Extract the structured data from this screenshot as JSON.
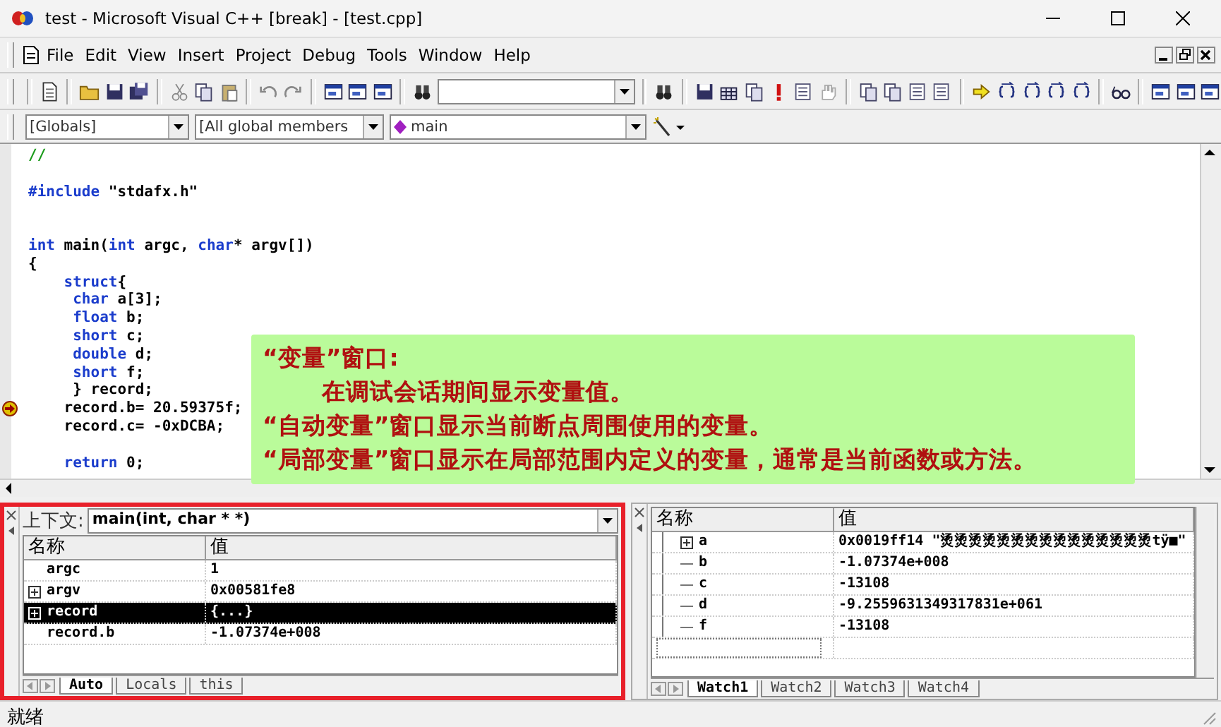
{
  "window": {
    "title": "test - Microsoft Visual C++ [break] - [test.cpp]"
  },
  "menu": [
    {
      "label": "File"
    },
    {
      "label": "Edit"
    },
    {
      "label": "View"
    },
    {
      "label": "Insert"
    },
    {
      "label": "Project"
    },
    {
      "label": "Debug"
    },
    {
      "label": "Tools"
    },
    {
      "label": "Window"
    },
    {
      "label": "Help"
    }
  ],
  "scope_bar": {
    "class_combo": "[Globals]",
    "members_combo": "[All global members",
    "function_combo": "main"
  },
  "editor": {
    "lines": [
      {
        "current": false,
        "segments": [
          {
            "kind": "comment",
            "text": "//"
          }
        ]
      },
      {
        "current": false
      },
      {
        "current": false,
        "segments": [
          {
            "kind": "kw",
            "text": "#include"
          },
          {
            "kind": "text",
            "text": " \"stdafx.h\""
          }
        ]
      },
      {
        "current": false
      },
      {
        "current": false
      },
      {
        "current": false,
        "segments": [
          {
            "kind": "kw",
            "text": "int"
          },
          {
            "kind": "text",
            "text": " main("
          },
          {
            "kind": "kw",
            "text": "int"
          },
          {
            "kind": "text",
            "text": " argc, "
          },
          {
            "kind": "kw",
            "text": "char"
          },
          {
            "kind": "text",
            "text": "* argv[])"
          }
        ]
      },
      {
        "current": false,
        "segments": [
          {
            "kind": "text",
            "text": "{"
          }
        ]
      },
      {
        "current": false,
        "segments": [
          {
            "kind": "kw",
            "text": "    struct"
          },
          {
            "kind": "text",
            "text": "{"
          }
        ]
      },
      {
        "current": false,
        "segments": [
          {
            "kind": "kw",
            "text": "     char"
          },
          {
            "kind": "text",
            "text": " a[3];"
          }
        ]
      },
      {
        "current": false,
        "segments": [
          {
            "kind": "kw",
            "text": "     float"
          },
          {
            "kind": "text",
            "text": " b;"
          }
        ]
      },
      {
        "current": false,
        "segments": [
          {
            "kind": "kw",
            "text": "     short"
          },
          {
            "kind": "text",
            "text": " c;"
          }
        ]
      },
      {
        "current": false,
        "segments": [
          {
            "kind": "kw",
            "text": "     double"
          },
          {
            "kind": "text",
            "text": " d;"
          }
        ]
      },
      {
        "current": false,
        "segments": [
          {
            "kind": "kw",
            "text": "     short"
          },
          {
            "kind": "text",
            "text": " f;"
          }
        ]
      },
      {
        "current": false,
        "segments": [
          {
            "kind": "text",
            "text": "     } record;"
          }
        ]
      },
      {
        "current": true,
        "segments": [
          {
            "kind": "text",
            "text": "    record.b= 20.59375f;"
          }
        ]
      },
      {
        "current": false,
        "segments": [
          {
            "kind": "text",
            "text": "    record.c= -0xDCBA;"
          }
        ]
      },
      {
        "current": false
      },
      {
        "current": false,
        "segments": [
          {
            "kind": "kw",
            "text": "    return"
          },
          {
            "kind": "text",
            "text": " 0;"
          }
        ]
      }
    ]
  },
  "callout": {
    "lines": [
      {
        "text": "“变量”窗口:",
        "indented": false
      },
      {
        "text": "在调试会话期间显示变量值。",
        "indented": true
      },
      {
        "text": "“自动变量”窗口显示当前断点周围使用的变量。",
        "indented": false
      },
      {
        "text": "“局部变量”窗口显示在局部范围内定义的变量，通常是当前函数或方法。",
        "indented": false
      }
    ]
  },
  "variables": {
    "context_label": "上下文:",
    "context": "main(int, char * *)",
    "columns": [
      "名称",
      "值"
    ],
    "rows": [
      {
        "name": "argc",
        "value": "1",
        "expandable": false,
        "selected": false
      },
      {
        "name": "argv",
        "value": "0x00581fe8",
        "expandable": true,
        "selected": false
      },
      {
        "name": "record",
        "value": "{...}",
        "expandable": true,
        "selected": true
      },
      {
        "name": "record.b",
        "value": "-1.07374e+008",
        "expandable": false,
        "selected": false
      }
    ],
    "tabs": [
      {
        "label": "Auto",
        "selected": true
      },
      {
        "label": "Locals",
        "selected": false
      },
      {
        "label": "this",
        "selected": false
      }
    ]
  },
  "watch": {
    "columns": [
      "名称",
      "值"
    ],
    "rows": [
      {
        "name": "a",
        "value": "0x0019ff14 \"烫烫烫烫烫烫烫烫烫烫烫烫烫烫烫tÿ■\"",
        "expandable": true
      },
      {
        "name": "b",
        "value": "-1.07374e+008",
        "expandable": false
      },
      {
        "name": "c",
        "value": "-13108",
        "expandable": false
      },
      {
        "name": "d",
        "value": "-9.2559631349317831e+061",
        "expandable": false
      },
      {
        "name": "f",
        "value": "-13108",
        "expandable": false
      }
    ],
    "tabs": [
      {
        "label": "Watch1",
        "selected": true
      },
      {
        "label": "Watch2",
        "selected": false
      },
      {
        "label": "Watch3",
        "selected": false
      },
      {
        "label": "Watch4",
        "selected": false
      }
    ]
  },
  "status_bar": {
    "text": "就绪"
  }
}
